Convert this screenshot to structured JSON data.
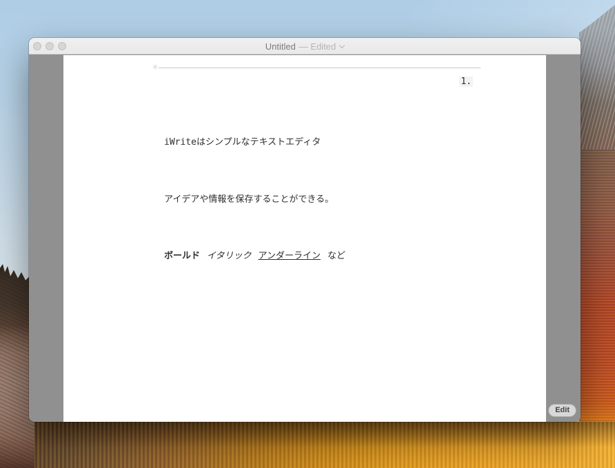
{
  "colors": {
    "desktop-sky": "#aecde6",
    "foliage-orange": "#e9971f",
    "window-margin": "#909090",
    "titlebar-bg": "#e9e9e9",
    "page-bg": "#ffffff",
    "doc-text": "#2e2e2e",
    "title-text": "#7b7b7b",
    "title-dim": "#b5b5b5",
    "ruler-line": "#c9c9c9",
    "edit-btn-bg": "#d8d8d8",
    "edit-btn-text": "#434343"
  },
  "titlebar": {
    "title": "Untitled",
    "edited": "— Edited"
  },
  "document": {
    "page_number": "1.",
    "line1": "iWriteはシンプルなテキストエディタ",
    "line2": "アイデアや情報を保存することができる。",
    "line3_bold": "ボールド",
    "line3_italic": "イタリック",
    "line3_underline": "アンダーライン",
    "line3_suffix": "など"
  },
  "buttons": {
    "edit": "Edit"
  }
}
